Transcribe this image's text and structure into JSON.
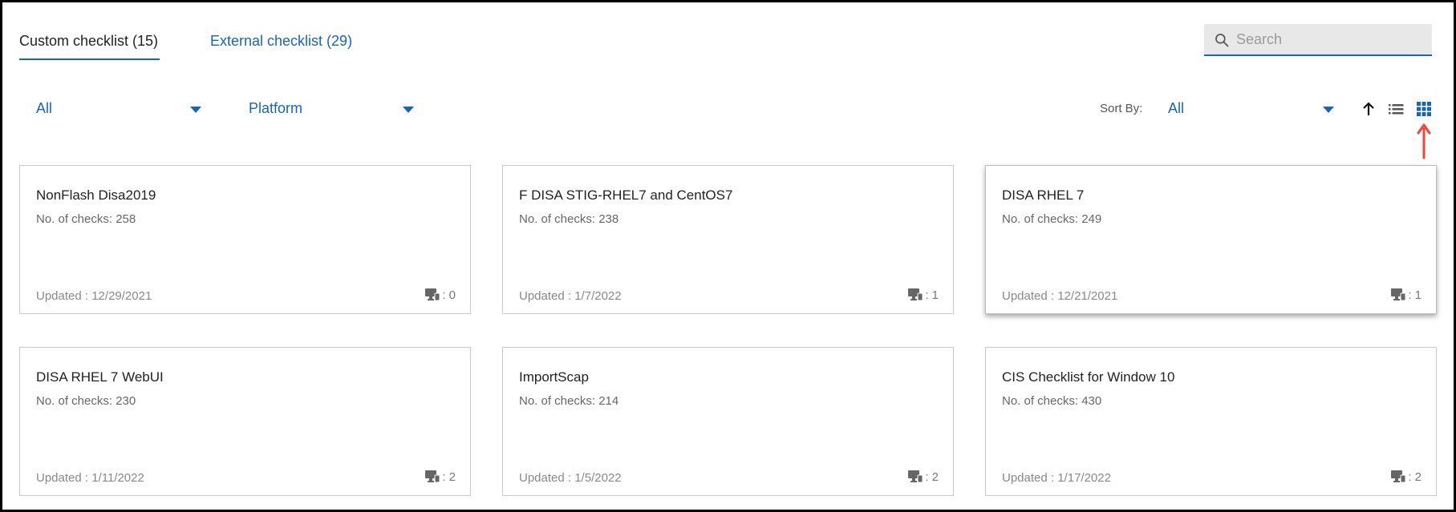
{
  "tabs": [
    {
      "label": "Custom checklist (15)",
      "active": true
    },
    {
      "label": "External checklist (29)",
      "active": false
    }
  ],
  "search": {
    "placeholder": "Search",
    "value": ""
  },
  "filters": {
    "type_selected": "All",
    "platform_selected": "Platform"
  },
  "sort": {
    "label": "Sort By:",
    "selected": "All",
    "direction_icon": "arrow-up-icon"
  },
  "view_toggle": {
    "list_icon": "list-view-icon",
    "grid_icon": "grid-view-icon",
    "active": "grid"
  },
  "colors": {
    "accent": "#1565c0",
    "annotation_arrow": "#f44336"
  },
  "checklists": [
    {
      "title": "NonFlash Disa2019",
      "checks": "No. of checks: 258",
      "updated": "Updated : 12/29/2021",
      "machines": ": 0"
    },
    {
      "title": "F DISA STIG-RHEL7 and CentOS7",
      "checks": "No. of checks: 238",
      "updated": "Updated : 1/7/2022",
      "machines": ": 1"
    },
    {
      "title": "DISA RHEL 7",
      "checks": "No. of checks: 249",
      "updated": "Updated : 12/21/2021",
      "machines": ": 1"
    },
    {
      "title": "DISA RHEL 7 WebUI",
      "checks": "No. of checks: 230",
      "updated": "Updated : 1/11/2022",
      "machines": ": 2"
    },
    {
      "title": "ImportScap",
      "checks": "No. of checks: 214",
      "updated": "Updated : 1/5/2022",
      "machines": ": 2"
    },
    {
      "title": "CIS Checklist for Window 10",
      "checks": "No. of checks: 430",
      "updated": "Updated : 1/17/2022",
      "machines": ": 2"
    }
  ]
}
